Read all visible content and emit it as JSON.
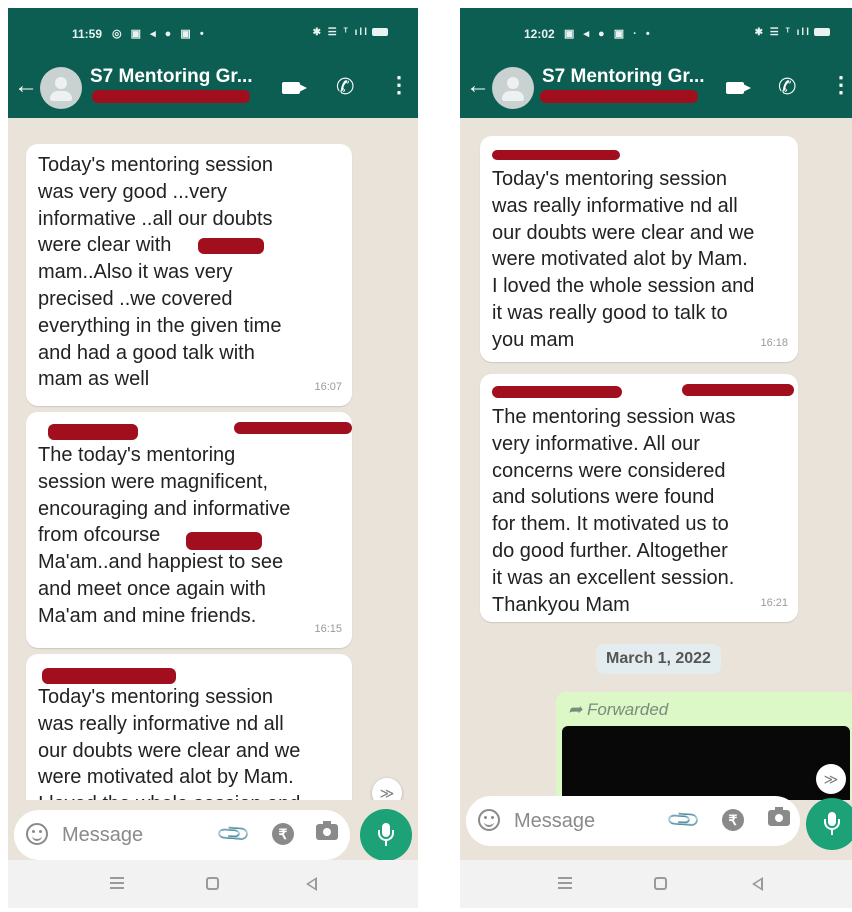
{
  "left_phone": {
    "status": {
      "time": "11:59",
      "icons": "◎ ▣ ◂ ● ▣ •",
      "right_icons": "✱ ☰ ᵀ ıll"
    },
    "chat_title": "S7 Mentoring Gr...",
    "messages": [
      {
        "text": "Today's mentoring session\nwas very good ...very\ninformative ..all our doubts\nwere clear with\nmam..Also it was very\nprecised ..we covered\neverything in the given time\nand had a good talk with\nmam as well",
        "time": "16:07"
      },
      {
        "text": "The today's mentoring\nsession were magnificent,\nencouraging and informative\nfrom ofcourse\nMa'am..and happiest to see\nand meet once again with\nMa'am and mine friends.",
        "time": "16:15"
      },
      {
        "text": "Today's mentoring session\nwas really informative nd all\nour doubts were clear and we\nwere motivated alot by Mam.\nI loved the whole session and",
        "time": ""
      }
    ],
    "composer_placeholder": "Message"
  },
  "right_phone": {
    "status": {
      "time": "12:02",
      "icons": "▣ ◂ ● ▣ · •",
      "right_icons": "✱ ☰ ᵀ ıll"
    },
    "chat_title": "S7 Mentoring Gr...",
    "messages": [
      {
        "text": "Today's mentoring session\nwas really informative nd all\nour doubts were clear and we\nwere motivated alot by Mam.\nI loved the whole session and\nit was really good to talk to\nyou mam",
        "time": "16:18"
      },
      {
        "text": "The mentoring session was\nvery informative. All our\nconcerns were considered\nand solutions were found\nfor  them. It motivated us to\ndo good further. Altogether\nit was an excellent session.\nThankyou Mam",
        "time": "16:21"
      }
    ],
    "date_chip": "March 1, 2022",
    "forwarded_label": "Forwarded",
    "composer_placeholder": "Message"
  },
  "icons": {
    "back": "←",
    "call": "✆",
    "menu": "⋮",
    "chevrons": "≫",
    "rupee": "₹",
    "attach": "📎"
  },
  "colors": {
    "header": "#0d5e52",
    "accent": "#1da176",
    "chat_bg": "#e9e3da",
    "redaction": "#a10f1f",
    "forward_bg": "#dcf8c6"
  }
}
